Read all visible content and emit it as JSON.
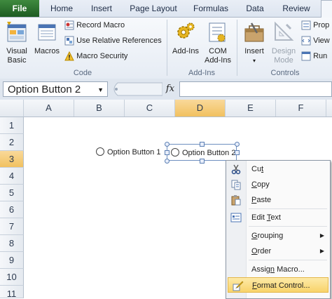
{
  "tabs": [
    "File",
    "Home",
    "Insert",
    "Page Layout",
    "Formulas",
    "Data",
    "Review"
  ],
  "ribbon": {
    "code_group": {
      "label": "Code",
      "visual_basic": "Visual Basic",
      "macros": "Macros",
      "record_macro": "Record Macro",
      "use_relative": "Use Relative References",
      "macro_security": "Macro Security"
    },
    "addins_group": {
      "label": "Add-Ins",
      "add_ins": "Add-Ins",
      "com_add_ins": "COM Add-Ins"
    },
    "controls_group": {
      "label": "Controls",
      "insert": "Insert",
      "design_mode": "Design Mode",
      "properties": "Prop",
      "view_code": "View",
      "run_dialog": "Run"
    }
  },
  "formula_bar": {
    "name_box": "Option Button 2",
    "fx": "fx",
    "value": ""
  },
  "columns": [
    "A",
    "B",
    "C",
    "D",
    "E",
    "F"
  ],
  "rows": [
    "1",
    "2",
    "3",
    "4",
    "5",
    "6",
    "7",
    "8",
    "9",
    "10",
    "11"
  ],
  "controls": {
    "option1": "Option Button 1",
    "option2": "Option Button 2"
  },
  "context_menu": {
    "cut": {
      "pre": "Cu",
      "acc": "t",
      "post": ""
    },
    "copy": {
      "pre": "",
      "acc": "C",
      "post": "opy"
    },
    "paste": {
      "pre": "",
      "acc": "P",
      "post": "aste"
    },
    "edit_text": {
      "pre": "Edit ",
      "acc": "T",
      "post": "ext"
    },
    "grouping": {
      "pre": "",
      "acc": "G",
      "post": "rouping"
    },
    "order": {
      "pre": "",
      "acc": "O",
      "post": "rder"
    },
    "assign_macro": {
      "pre": "Assig",
      "acc": "n",
      "post": " Macro..."
    },
    "format_control": {
      "pre": "",
      "acc": "F",
      "post": "ormat Control..."
    }
  },
  "colors": {
    "file_tab": "#2a6a2f",
    "highlight": "#f8d36a",
    "selection": "#f1c15f"
  }
}
